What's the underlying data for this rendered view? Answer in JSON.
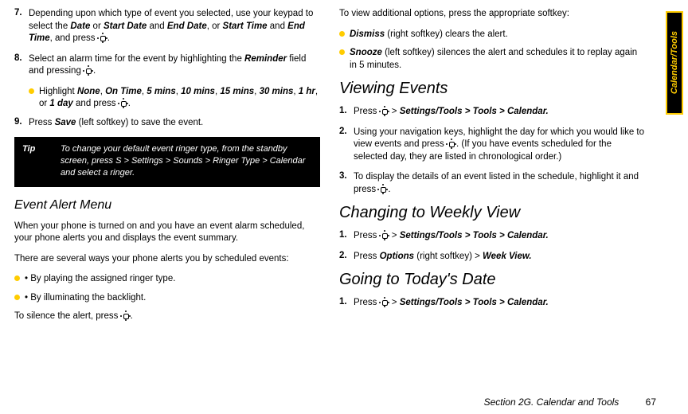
{
  "sidetab": "Calendar/Tools",
  "left": {
    "step7_num": "7.",
    "step7_text_a": "Depending upon which type of event you selected, use your keypad to select the ",
    "step7_date": "Date",
    "step7_or1": " or ",
    "step7_sd": "Start Date",
    "step7_and1": " and ",
    "step7_ed": "End Date",
    "step7_comma_or": ", or ",
    "step7_st": "Start Time",
    "step7_and2": " and ",
    "step7_et": "End Time",
    "step7_press": ", and press ",
    "step7_dot": ".",
    "step8_num": "8.",
    "step8_a": "Select an alarm time for the event by highlighting the ",
    "step8_rem": "Reminder",
    "step8_b": " field and pressing ",
    "step8_dot": ".",
    "sub8_a": "Highlight ",
    "sub8_none": "None",
    "sub8_ontime": "On Time",
    "sub8_5": "5 mins",
    "sub8_10": "10 mins",
    "sub8_15": "15 mins",
    "sub8_30": "30 mins",
    "sub8_1hr": "1 hr",
    "sub8_1day": "1 day",
    "sub8_sep": ", ",
    "sub8_or": ", or ",
    "sub8_press": " and press ",
    "sub8_dot": ".",
    "step9_num": "9.",
    "step9_a": "Press ",
    "step9_save": "Save",
    "step9_b": " (left softkey) to save the event.",
    "tip_label": "Tip",
    "tip_text": "To change your default event ringer type, from the standby screen, press S > Settings > Sounds > Ringer Type > Calendar and select a ringer.",
    "eam_title": "Event Alert Menu",
    "eam_p1": "When your phone is turned on and you have an event alarm scheduled, your phone alerts you and displays the event summary.",
    "eam_p2": "There are several ways your phone alerts you by scheduled events:",
    "eam_b1": "• By playing the assigned ringer type.",
    "eam_b2": "• By illuminating the backlight.",
    "eam_silence_a": "To silence the alert, press ",
    "eam_silence_dot": "."
  },
  "right": {
    "intro": "To view additional options, press the appropriate softkey:",
    "dismiss_word": "Dismiss",
    "dismiss_rest": " (right softkey) clears the alert.",
    "snooze_word": "Snooze",
    "snooze_rest": " (left softkey) silences the alert and schedules it to replay again in 5 minutes.",
    "view_title": "Viewing Events",
    "v1_num": "1.",
    "v1_a": "Press ",
    "v1_b": " > ",
    "v1_path": "Settings/Tools > Tools > Calendar.",
    "v2_num": "2.",
    "v2_a": "Using your navigation keys, highlight the day for which you would like to view events and press ",
    "v2_b": ". (If you have events scheduled for the selected day, they are listed in chronological order.)",
    "v3_num": "3.",
    "v3_a": "To display the details of an event listed in the schedule, highlight it and press ",
    "v3_b": ".",
    "week_title": "Changing to Weekly View",
    "w1_num": "1.",
    "w1_a": "Press ",
    "w1_b": " > ",
    "w1_path": "Settings/Tools > Tools > Calendar.",
    "w2_num": "2.",
    "w2_a": "Press ",
    "w2_opt": "Options",
    "w2_b": " (right softkey) > ",
    "w2_wv": "Week View.",
    "today_title": "Going to Today's Date",
    "t1_num": "1.",
    "t1_a": "Press ",
    "t1_b": " > ",
    "t1_path": "Settings/Tools  > Tools > Calendar."
  },
  "footer_text": "Section 2G. Calendar and Tools",
  "footer_page": "67"
}
